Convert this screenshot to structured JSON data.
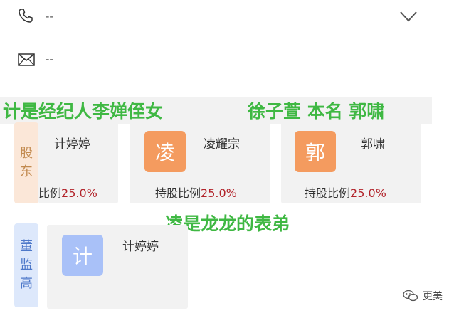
{
  "contact": {
    "phone_value": "--",
    "email_value": "--"
  },
  "annotations": {
    "top_left": "计是经纪人李婵侄女",
    "top_right": "徐子萱 本名 郭啸",
    "middle": "凌是龙龙的表弟"
  },
  "shareholders": {
    "tab_label_1": "股",
    "tab_label_2": "东",
    "cards": [
      {
        "name": "计婷婷",
        "ratio_label": "比例",
        "ratio_value": "25.0%"
      },
      {
        "avatar": "凌",
        "name": "凌耀宗",
        "ratio_label": "持股比例",
        "ratio_value": "25.0%"
      },
      {
        "avatar": "郭",
        "name": "郭啸",
        "ratio_label": "持股比例",
        "ratio_value": "25.0%"
      }
    ]
  },
  "board": {
    "tab_label_1": "董",
    "tab_label_2": "监",
    "tab_label_3": "高",
    "cards": [
      {
        "avatar": "计",
        "name": "计婷婷"
      }
    ]
  },
  "watermark": {
    "text": "更美",
    "icon": "wechat-icon"
  },
  "colors": {
    "annotation_green": "#3fb843",
    "ratio_red": "#b2232a",
    "avatar_orange": "#f49b5f",
    "avatar_blue": "#a9c1f8"
  }
}
